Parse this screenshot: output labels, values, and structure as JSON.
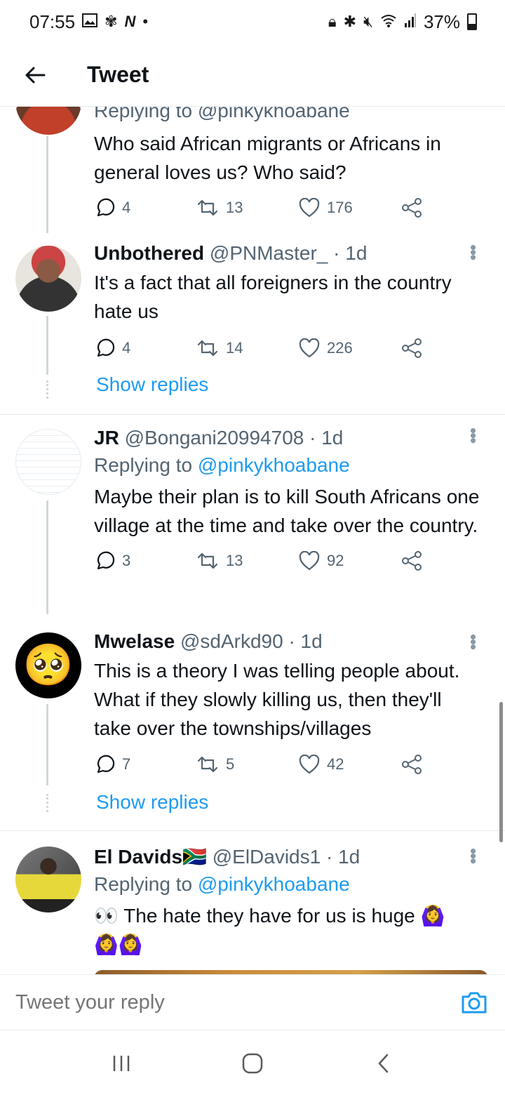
{
  "status_bar": {
    "time": "07:55",
    "battery": "37%",
    "left_icons": [
      "image-icon",
      "fan-icon",
      "n-icon",
      "dot-icon"
    ],
    "right_icons": [
      "lock-icon",
      "bluetooth-icon",
      "mute-icon",
      "wifi-icon",
      "signal-icon",
      "battery-icon"
    ]
  },
  "header": {
    "title": "Tweet",
    "back_icon": "arrow-left-icon"
  },
  "tweets": [
    {
      "reply_line_cut": "Replying to @pinkykhoabane",
      "text": "Who said African migrants or Africans in general loves us? Who said?",
      "replies": "4",
      "retweets": "13",
      "likes": "176"
    },
    {
      "name": "Unbothered",
      "handle": "@PNMaster_",
      "time": "· 1d",
      "text": "It's a fact that all foreigners in the country hate us",
      "replies": "4",
      "retweets": "14",
      "likes": "226",
      "show_replies": "Show replies"
    },
    {
      "name": "JR",
      "handle": "@Bongani20994708",
      "time": "· 1d",
      "replying_prefix": "Replying to ",
      "replying_mention": "@pinkykhoabane",
      "text": "Maybe their plan is to kill South Africans one village at the time and take over the country.",
      "replies": "3",
      "retweets": "13",
      "likes": "92"
    },
    {
      "name": "Mwelase",
      "handle": "@sdArkd90",
      "time": "· 1d",
      "text": "This is a theory I was telling people about. What if they slowly killing us, then they'll take over the townships/villages",
      "replies": "7",
      "retweets": "5",
      "likes": "42",
      "show_replies": "Show replies"
    },
    {
      "name": "El Davids",
      "name_flag": "🇿🇦",
      "handle": "@ElDavids1",
      "time": "· 1d",
      "replying_prefix": "Replying to ",
      "replying_mention": "@pinkykhoabane",
      "text_prefix": "👀",
      "text": " The hate they have for us is huge ",
      "text_suffix": "🙆‍♀️",
      "text_line2": "🙆‍♀️🙆‍♀️"
    }
  ],
  "reply_bar": {
    "placeholder": "Tweet your reply",
    "camera_icon": "camera-icon"
  },
  "nav_bar": {
    "icons": [
      "recents-icon",
      "home-icon",
      "back-icon"
    ]
  },
  "colors": {
    "accent": "#1d9bf0",
    "secondary_text": "#536471",
    "divider": "#e6ecf0"
  }
}
